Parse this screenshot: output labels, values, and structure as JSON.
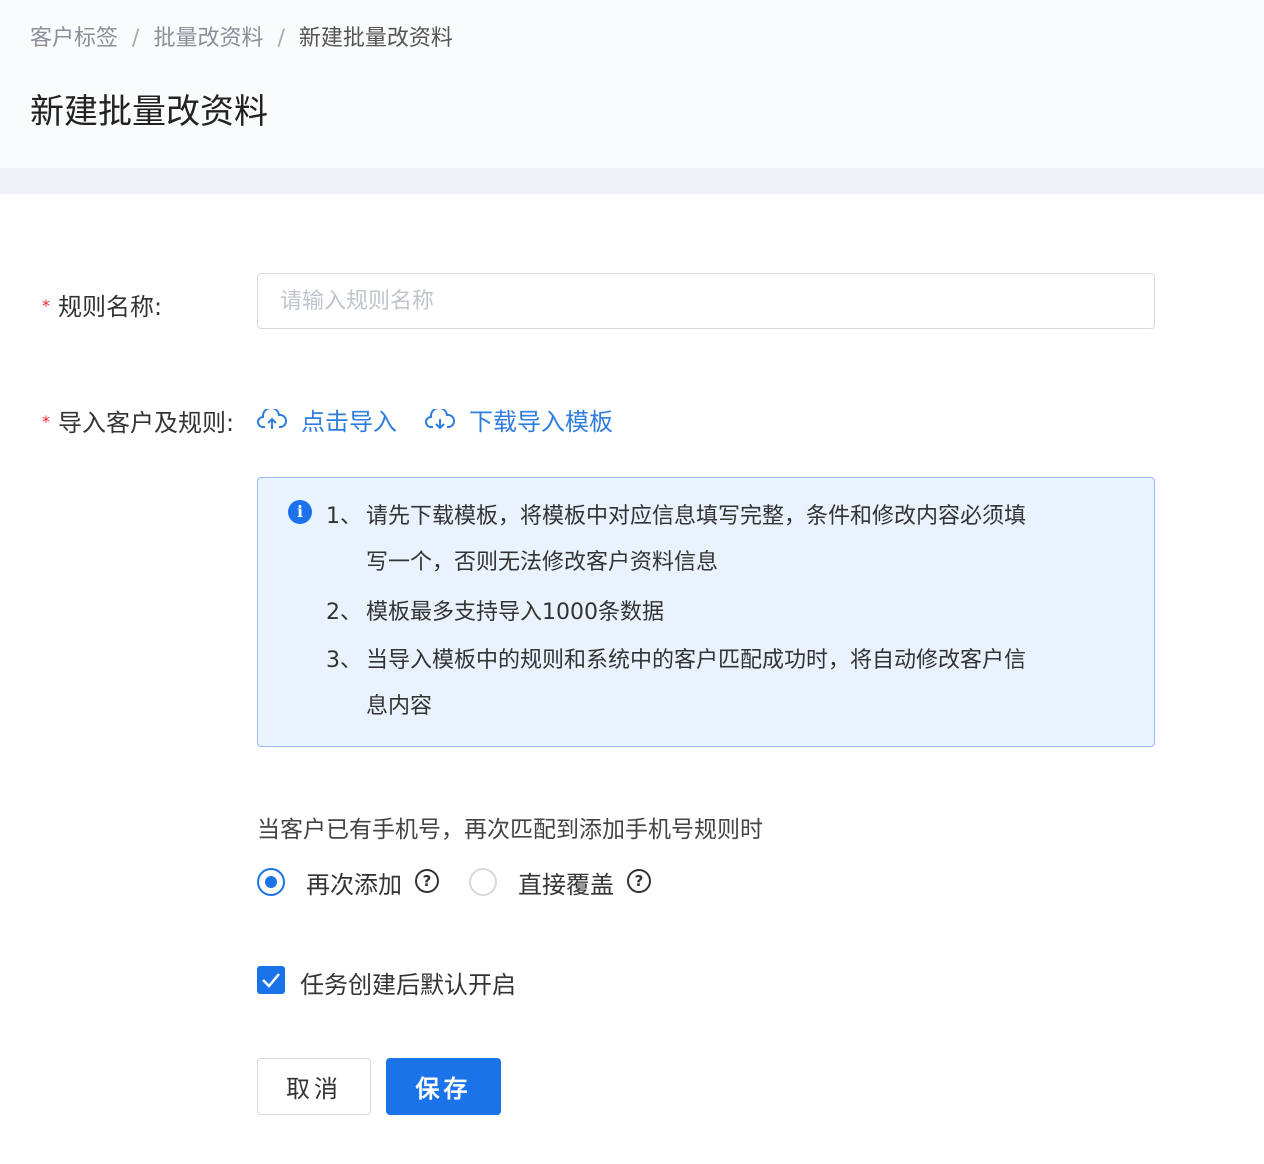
{
  "breadcrumb": {
    "items": [
      "客户标签",
      "批量改资料",
      "新建批量改资料"
    ],
    "separator": "/"
  },
  "page_title": "新建批量改资料",
  "form": {
    "rule_name": {
      "required_mark": "*",
      "label": "规则名称:",
      "placeholder": "请输入规则名称",
      "value": ""
    },
    "import": {
      "required_mark": "*",
      "label": "导入客户及规则:",
      "upload_link": "点击导入",
      "upload_icon": "cloud-upload-icon",
      "download_link": "下载导入模板",
      "download_icon": "cloud-download-icon"
    },
    "info": {
      "icon": "info-icon",
      "items": [
        {
          "num": "1、",
          "lines": [
            "请先下载模板，将模板中对应信息填写完整，条件和修改内容必须填",
            "写一个，否则无法修改客户资料信息"
          ]
        },
        {
          "num": "2、",
          "lines": [
            "模板最多支持导入1000条数据"
          ]
        },
        {
          "num": "3、",
          "lines": [
            "当导入模板中的规则和系统中的客户匹配成功时，将自动修改客户信",
            "息内容"
          ]
        }
      ]
    },
    "phone_rule": {
      "question": "当客户已有手机号，再次匹配到添加手机号规则时",
      "options": [
        {
          "label": "再次添加",
          "checked": true,
          "help_icon": "question-circle-icon"
        },
        {
          "label": "直接覆盖",
          "checked": false,
          "help_icon": "question-circle-icon"
        }
      ]
    },
    "auto_enable": {
      "label": "任务创建后默认开启",
      "checked": true
    }
  },
  "buttons": {
    "cancel": "取消",
    "save": "保存"
  },
  "colors": {
    "primary": "#1a73e8",
    "link": "#2f7dde",
    "required": "#f5222d",
    "info_bg": "#eaf3fd",
    "info_border": "#94bdf0"
  }
}
